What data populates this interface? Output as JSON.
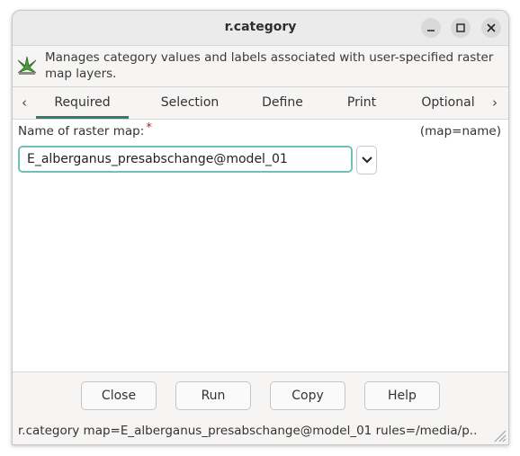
{
  "window": {
    "title": "r.category"
  },
  "description": {
    "text": "Manages category values and labels associated with user-specified raster map layers.",
    "icon": "grass-module-icon"
  },
  "tabs": {
    "items": [
      {
        "label": "Required",
        "active": true
      },
      {
        "label": "Selection"
      },
      {
        "label": "Define"
      },
      {
        "label": "Print"
      },
      {
        "label": "Optional"
      }
    ],
    "prev_arrow": "‹",
    "next_arrow": "›"
  },
  "field": {
    "label": "Name of raster map:",
    "required_marker": "*",
    "hint": "(map=name)",
    "value": "E_alberganus_presabschange@model_01"
  },
  "buttons": {
    "close": "Close",
    "run": "Run",
    "copy": "Copy",
    "help": "Help"
  },
  "status": {
    "command": "r.category map=E_alberganus_presabschange@model_01 rules=/media/p..."
  },
  "colors": {
    "accent": "#2d7d70",
    "focus_border": "#6fc2b4",
    "required": "#d02020"
  }
}
